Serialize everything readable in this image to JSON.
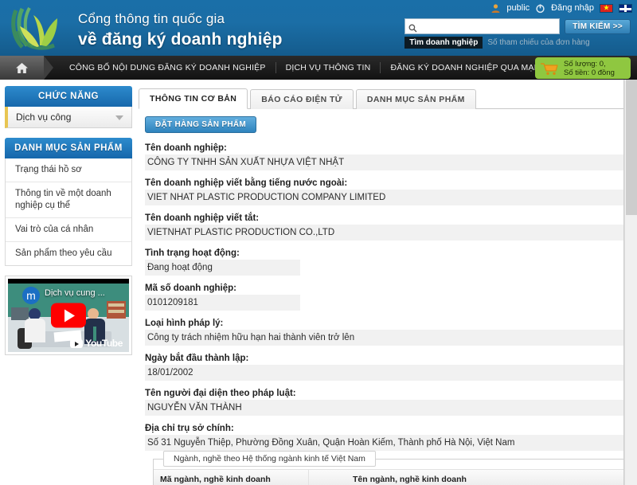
{
  "header": {
    "brand_line1": "Cổng thông tin quốc gia",
    "brand_line2": "về đăng ký doanh nghiệp",
    "logo_icon": "leaf-logo-icon",
    "user_icon": "user-icon",
    "username": "public",
    "power_icon": "power-icon",
    "login_label": "Đăng nhập",
    "flag_vn": "flag-vietnam-icon",
    "flag_uk": "flag-uk-icon",
    "search": {
      "icon": "search-icon",
      "value": "",
      "placeholder": "",
      "button_label": "TÌM KIẾM >>",
      "tabs": [
        {
          "label": "Tìm doanh nghiệp",
          "active": true
        },
        {
          "label": "Số tham chiếu của đơn hàng",
          "active": false
        }
      ]
    }
  },
  "nav": {
    "home_icon": "home-icon",
    "items": [
      "CÔNG BỐ NỘI DUNG ĐĂNG KÝ DOANH NGHIỆP",
      "DỊCH VỤ THÔNG TIN",
      "ĐĂNG KÝ DOANH NGHIỆP QUA MẠNG ĐIỆN TỬ"
    ],
    "cart": {
      "icon": "shopping-cart-icon",
      "line1": "Số lượng: 0,",
      "line2": "Số tiền: 0 đồng",
      "color": "#8fc740"
    }
  },
  "sidebar": {
    "functions_panel": {
      "title": "CHỨC NĂNG",
      "dropdown_value": "Dịch vụ công",
      "dropdown_icon": "chevron-down-icon"
    },
    "catalog_panel": {
      "title": "DANH MỤC SẢN PHẨM",
      "items": [
        "Trạng thái hồ sơ",
        "Thông tin về một doanh nghiệp cụ thể",
        "Vai trò của cá nhân",
        "Sản phẩm theo yêu cầu"
      ]
    },
    "video": {
      "channel_initial": "m",
      "title": "Dịch vụ cung ...",
      "play_icon": "play-button-icon",
      "brand": "YouTube",
      "brand_icon": "youtube-icon"
    }
  },
  "main": {
    "tabs": [
      {
        "label": "THÔNG TIN CƠ BẢN",
        "active": true
      },
      {
        "label": "BÁO CÁO ĐIỆN TỬ",
        "active": false
      },
      {
        "label": "DANH MỤC SẢN PHẨM",
        "active": false
      }
    ],
    "order_button": "ĐẶT HÀNG SẢN PHẨM",
    "fields": [
      {
        "label": "Tên doanh nghiệp:",
        "value": "CÔNG TY TNHH SẢN XUẤT NHỰA VIỆT NHẬT",
        "narrow": false
      },
      {
        "label": "Tên doanh nghiệp viết bằng tiếng nước ngoài:",
        "value": "VIET NHAT PLASTIC PRODUCTION COMPANY LIMITED",
        "narrow": false
      },
      {
        "label": "Tên doanh nghiệp viết tắt:",
        "value": "VIETNHAT PLASTIC PRODUCTION CO.,LTD",
        "narrow": false
      },
      {
        "label": "Tình trạng hoạt động:",
        "value": "Đang hoạt động",
        "narrow": true
      },
      {
        "label": "Mã số doanh nghiệp:",
        "value": "0101209181",
        "narrow": true
      },
      {
        "label": "Loại hình pháp lý:",
        "value": "Công ty trách nhiệm hữu hạn hai thành viên trở lên",
        "narrow": false
      },
      {
        "label": "Ngày bắt đầu thành lập:",
        "value": "18/01/2002",
        "narrow": false
      },
      {
        "label": "Tên người đại diện theo pháp luật:",
        "value": "NGUYỄN VĂN THÀNH",
        "narrow": false
      },
      {
        "label": "Địa chỉ trụ sở chính:",
        "value": "Số 31 Nguyễn Thiệp, Phường Đồng Xuân, Quận Hoàn Kiếm, Thành phố Hà Nội, Việt Nam",
        "narrow": false
      }
    ],
    "industry_section": {
      "legend": "Ngành, nghề theo Hệ thống ngành kinh tế Việt Nam",
      "columns": [
        "Mã ngành, nghề kinh doanh",
        "Tên ngành, nghề kinh doanh"
      ]
    }
  }
}
